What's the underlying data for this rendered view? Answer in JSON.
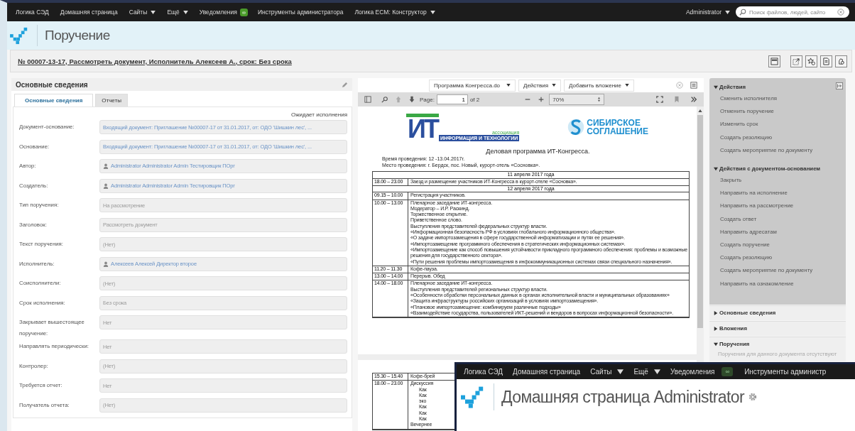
{
  "top_nav": {
    "items": [
      {
        "label": "Логика СЭД",
        "dropdown": false
      },
      {
        "label": "Домашняя страница",
        "dropdown": false
      },
      {
        "label": "Сайты",
        "dropdown": true
      },
      {
        "label": "Ещё",
        "dropdown": true
      },
      {
        "label": "Уведомления",
        "dropdown": false,
        "badge": "∞"
      },
      {
        "label": "Инструменты администратора",
        "dropdown": false
      },
      {
        "label": "Логика ECM: Конструктор",
        "dropdown": true
      }
    ],
    "user": "Administrator",
    "search": {
      "placeholder": "Поиск файлов, людей, сайто"
    }
  },
  "header": {
    "title": "Поручение"
  },
  "record": {
    "title": "№ 00007-13-17, Рассмотреть документ, Исполнитель Алексеев А., срок: Без срока"
  },
  "form": {
    "title": "Основные сведения",
    "tabs": [
      {
        "label": "Основные сведения",
        "selected": true
      },
      {
        "label": "Отчеты",
        "selected": false
      }
    ],
    "status": "Ожидает исполнения",
    "fields": [
      {
        "label": "Документ-основание:",
        "value": "Входящий документ: Приглашение №00007-17 от 31.01.2017, от: ОДО 'Шишкин лес', ...",
        "kind": "link"
      },
      {
        "label": "Основание:",
        "value": "Входящий документ: Приглашение №00007-17 от 31.01.2017, от: ОДО 'Шишкин лес', ...",
        "kind": "link"
      },
      {
        "label": "Автор:",
        "value": "Administrator Administrator Admin Тестировщик ПОрг",
        "kind": "person"
      },
      {
        "label": "Создатель:",
        "value": "Administrator Administrator Admin Тестировщик ПОрг",
        "kind": "person"
      },
      {
        "label": "Тип поручения:",
        "value": "На рассмотрение",
        "kind": "text"
      },
      {
        "label": "Заголовок:",
        "value": "Рассмотреть документ",
        "kind": "text"
      },
      {
        "label": "Текст поручения:",
        "value": "(Нет)",
        "kind": "text"
      },
      {
        "label": "Исполнитель:",
        "value": "Алексеев Алексей Директор второе",
        "kind": "person"
      },
      {
        "label": "Соисполнители:",
        "value": "(Нет)",
        "kind": "text"
      },
      {
        "label": "Срок исполнения:",
        "value": "Без срока",
        "kind": "text"
      },
      {
        "label": "Закрывает вышестоящее поручение:",
        "value": "Нет",
        "kind": "text"
      },
      {
        "label": "Направлять периодически:",
        "value": "Нет",
        "kind": "text"
      },
      {
        "label": "Контролер:",
        "value": "(Нет)",
        "kind": "text"
      },
      {
        "label": "Требуется отчет:",
        "value": "Нет",
        "kind": "text"
      },
      {
        "label": "Получатель отчета:",
        "value": "(Нет)",
        "kind": "text"
      }
    ]
  },
  "viewer": {
    "attachment": "Программа Конгресса.do",
    "actions_button": "Действия",
    "add_attachment_button": "Добавить вложение",
    "page_label": "Page:",
    "page": "1",
    "page_of": "of 2",
    "zoom": "70%",
    "logos": [
      {
        "kind": "it",
        "mark": "ИТ",
        "caption": "ассоциация",
        "subcaption": "ИНФОРМАЦИЯ И ТЕХНОЛОГИИ"
      },
      {
        "kind": "sib",
        "lines": [
          "СИБИРСКОЕ",
          "СОГЛАШЕНИЕ"
        ]
      }
    ],
    "heading": "Деловая программа ИТ-Конгресса.",
    "meta": [
      "Время проведения: 12 -13.04.2017г.",
      "Место проведения: г. Бердск, пос. Новый, курорт-отель «Сосновка»."
    ],
    "schedule": [
      {
        "kind": "date",
        "text": "11 апреля 2017 года"
      },
      {
        "kind": "slot",
        "time": "18.00 – 23.00",
        "lines": [
          "Заезд и размещение участников ИТ-Конгресса в курорт-отеле «Сосновка»."
        ]
      },
      {
        "kind": "date",
        "text": "12 апреля 2017 года"
      },
      {
        "kind": "slot",
        "time": "09.15 – 10.00",
        "lines": [
          "Регистрация участников."
        ]
      },
      {
        "kind": "slot",
        "time": "10.00 – 13.00",
        "lines": [
          "Пленарное заседание ИТ-конгресса.",
          "Модератор – И.Р. Раскинд.",
          "Торжественное открытие.",
          "Приветственное слово.",
          "Выступления представителей федеральных структур власти.",
          "«Информационная безопасность РФ в условиях глобального информационного общества».",
          "«О задаче импортозамещения в сфере государственной информатизации и путях ее решения».",
          "«Импортозамещение программного обеспечения в стратегических информационных системах».",
          "«Импортозамещение как способ повышения устойчивости прикладного программного обеспечения: проблемы и возможные решения для государственного сектора».",
          "«Пути решения проблемы импортозамещения в инфокоммуникационных системах связи специального назначения»."
        ]
      },
      {
        "kind": "slot",
        "time": "11.20 – 11.30",
        "lines": [
          "Кофе-пауза."
        ]
      },
      {
        "kind": "slot",
        "time": "13.00 – 14.00",
        "lines": [
          "Перерыв. Обед"
        ]
      },
      {
        "kind": "slot",
        "time": "14.00 – 18.00",
        "lines": [
          "Пленарное заседание ИТ-конгресса.",
          "Выступления представителей региональных структур власти.",
          "«Особенности обработки персональных данных в органах исполнительной власти и муниципальных образованиях»",
          "«Защита инфраструктуры российских организаций в условиях импортозамещения».",
          "«Плановое импортозамещение: комбинируем различные подходы»",
          "«Взаимодействие государства, пользователей ИКТ-решений и вендоров в вопросах информационной безопасности»."
        ]
      }
    ],
    "schedule_page2": [
      {
        "time": "15.30 – 15.40",
        "lines": [
          "Кофе-брей"
        ]
      },
      {
        "time": "18.00 – 23.00",
        "lines": [
          "Дискуссия"
        ],
        "bullets": [
          "Как",
          "Как",
          "эко",
          "Как",
          "Как",
          "Как"
        ],
        "after": "Вечернее"
      }
    ]
  },
  "side_panel": {
    "sections": [
      {
        "kind": "actions",
        "title": "Действия",
        "expanded": true,
        "items": [
          "Сменить исполнителя",
          "Отменить поручение",
          "Изменить срок",
          "Создать резолюцию",
          "Создать мероприятие по документу"
        ]
      },
      {
        "kind": "actions",
        "title": "Действия с документом-основанием",
        "expanded": true,
        "items": [
          "Закрыть",
          "Направить на исполнение",
          "Направить на рассмотрение",
          "Создать ответ",
          "Направить адресатам",
          "Создать поручение",
          "Создать резолюцию",
          "Создать мероприятие по документу",
          "Направить на ознакомление"
        ]
      },
      {
        "kind": "panel",
        "title": "Основные сведения",
        "expanded": false
      },
      {
        "kind": "panel",
        "title": "Вложения",
        "expanded": false
      },
      {
        "kind": "panel",
        "title": "Поручения",
        "expanded": true,
        "empty_text": "Поручения для данного документа отсутствуют"
      }
    ]
  },
  "overlay_window": {
    "nav": [
      {
        "label": "Логика СЭД",
        "dropdown": false
      },
      {
        "label": "Домашняя страница",
        "dropdown": false
      },
      {
        "label": "Сайты",
        "dropdown": true
      },
      {
        "label": "Ещё",
        "dropdown": true
      },
      {
        "label": "Уведомления",
        "dropdown": false,
        "badge": "∞"
      },
      {
        "label": "Инструменты администр",
        "dropdown": false
      }
    ],
    "title": "Домашняя страница Administrator"
  }
}
